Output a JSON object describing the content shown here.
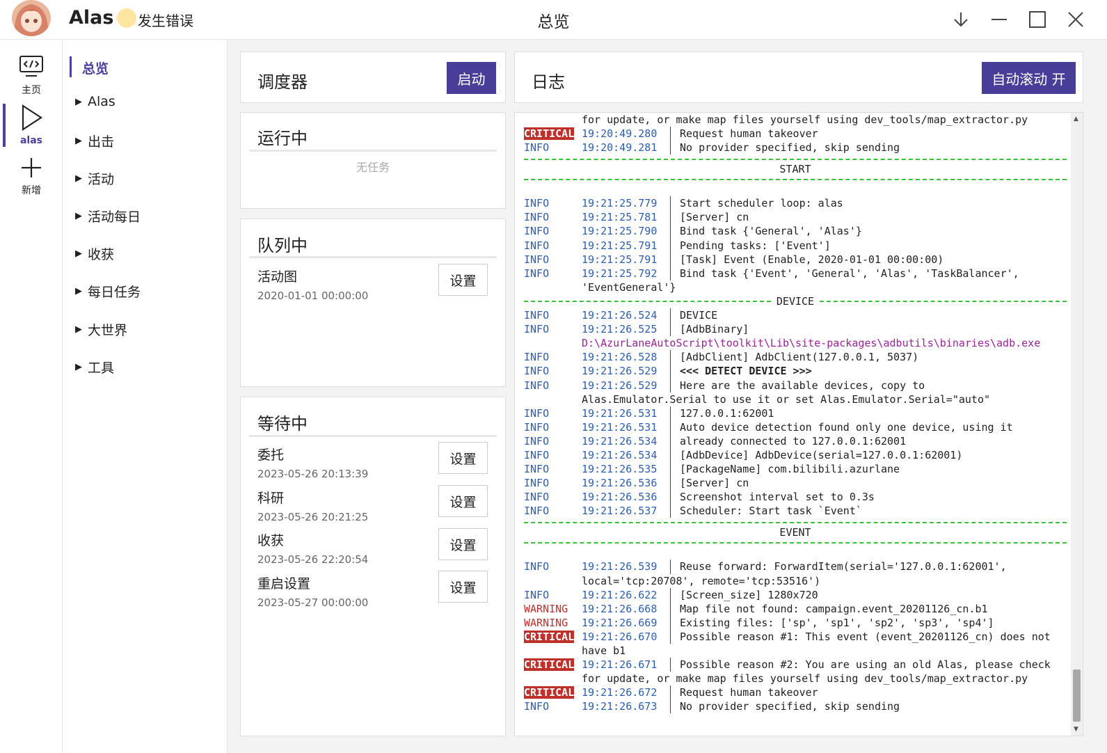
{
  "titlebar": {
    "app_name": "Alas",
    "status": "发生错误",
    "page_title": "总览"
  },
  "rail": {
    "items": [
      {
        "label": "主页",
        "icon": "code-monitor-icon"
      },
      {
        "label": "alas",
        "icon": "play-icon"
      },
      {
        "label": "新增",
        "icon": "plus-icon"
      }
    ]
  },
  "menu": {
    "active": "总览",
    "items": [
      "Alas",
      "出击",
      "活动",
      "活动每日",
      "收获",
      "每日任务",
      "大世界",
      "工具"
    ]
  },
  "scheduler": {
    "title": "调度器",
    "start_label": "启动"
  },
  "running": {
    "title": "运行中",
    "empty": "无任务"
  },
  "pending": {
    "title": "队列中",
    "tasks": [
      {
        "name": "活动图",
        "time": "2020-01-01 00:00:00",
        "button": "设置"
      }
    ]
  },
  "waiting": {
    "title": "等待中",
    "tasks": [
      {
        "name": "委托",
        "time": "2023-05-26 20:13:39",
        "button": "设置"
      },
      {
        "name": "科研",
        "time": "2023-05-26 20:21:25",
        "button": "设置"
      },
      {
        "name": "收获",
        "time": "2023-05-26 22:20:54",
        "button": "设置"
      },
      {
        "name": "重启设置",
        "time": "2023-05-27 00:00:00",
        "button": "设置"
      }
    ]
  },
  "log": {
    "title": "日志",
    "autoscroll_label": "自动滚动 开",
    "colors": {
      "info": "#2b5eb8",
      "warning": "#c0302b",
      "critical_bg": "#c0302b",
      "separator": "#36c436",
      "path": "#a0219e"
    },
    "lines": {
      "c0": "for update, or make map files yourself using dev_tools/map_extractor.py",
      "l1": {
        "level": "CRITICAL",
        "time": "19:20:49.280",
        "msg": "Request human takeover"
      },
      "l2": {
        "level": "INFO",
        "time": "19:20:49.281",
        "msg": "No provider specified, skip sending"
      },
      "banner_start": "START",
      "l3": {
        "level": "INFO",
        "time": "19:21:25.779",
        "msg": "Start scheduler loop: alas"
      },
      "l4": {
        "level": "INFO",
        "time": "19:21:25.781",
        "msg": "[Server] cn"
      },
      "l5": {
        "level": "INFO",
        "time": "19:21:25.790",
        "msg": "Bind task {'General', 'Alas'}"
      },
      "l6": {
        "level": "INFO",
        "time": "19:21:25.791",
        "msg": "Pending tasks: ['Event']"
      },
      "l7": {
        "level": "INFO",
        "time": "19:21:25.791",
        "msg": "[Task] Event (Enable, 2020-01-01 00:00:00)"
      },
      "l8": {
        "level": "INFO",
        "time": "19:21:25.792",
        "msg": "Bind task {'Event', 'General', 'Alas', 'TaskBalancer',"
      },
      "c8": "'EventGeneral'}",
      "banner_device": "DEVICE",
      "l9": {
        "level": "INFO",
        "time": "19:21:26.524",
        "msg": "DEVICE"
      },
      "l10": {
        "level": "INFO",
        "time": "19:21:26.525",
        "msg": "[AdbBinary]"
      },
      "c10": "D:\\AzurLaneAutoScript\\toolkit\\Lib\\site-packages\\adbutils\\binaries\\adb.exe",
      "l11": {
        "level": "INFO",
        "time": "19:21:26.528",
        "msg": "[AdbClient] AdbClient(127.0.0.1, 5037)"
      },
      "l12": {
        "level": "INFO",
        "time": "19:21:26.529",
        "msg": "<<< DETECT DEVICE >>>"
      },
      "l13": {
        "level": "INFO",
        "time": "19:21:26.529",
        "msg": "Here are the available devices, copy to"
      },
      "c13": "Alas.Emulator.Serial to use it or set Alas.Emulator.Serial=\"auto\"",
      "l14": {
        "level": "INFO",
        "time": "19:21:26.531",
        "msg": "127.0.0.1:62001"
      },
      "l15": {
        "level": "INFO",
        "time": "19:21:26.531",
        "msg": "Auto device detection found only one device, using it"
      },
      "l16": {
        "level": "INFO",
        "time": "19:21:26.534",
        "msg": "already connected to 127.0.0.1:62001"
      },
      "l17": {
        "level": "INFO",
        "time": "19:21:26.534",
        "msg": "[AdbDevice] AdbDevice(serial=127.0.0.1:62001)"
      },
      "l18": {
        "level": "INFO",
        "time": "19:21:26.535",
        "msg": "[PackageName] com.bilibili.azurlane"
      },
      "l19": {
        "level": "INFO",
        "time": "19:21:26.536",
        "msg": "[Server] cn"
      },
      "l20": {
        "level": "INFO",
        "time": "19:21:26.536",
        "msg": "Screenshot interval set to 0.3s"
      },
      "l21": {
        "level": "INFO",
        "time": "19:21:26.537",
        "msg": "Scheduler: Start task `Event`"
      },
      "banner_event": "EVENT",
      "l22": {
        "level": "INFO",
        "time": "19:21:26.539",
        "msg": "Reuse forward: ForwardItem(serial='127.0.0.1:62001',"
      },
      "c22": "local='tcp:20708', remote='tcp:53516')",
      "l23": {
        "level": "INFO",
        "time": "19:21:26.622",
        "msg": "[Screen_size] 1280x720"
      },
      "l24": {
        "level": "WARNING",
        "time": "19:21:26.668",
        "msg": "Map file not found: campaign.event_20201126_cn.b1"
      },
      "l25": {
        "level": "WARNING",
        "time": "19:21:26.669",
        "msg": "Existing files: ['sp', 'sp1', 'sp2', 'sp3', 'sp4']"
      },
      "l26": {
        "level": "CRITICAL",
        "time": "19:21:26.670",
        "msg": "Possible reason #1: This event (event_20201126_cn) does not"
      },
      "c26": "have b1",
      "l27": {
        "level": "CRITICAL",
        "time": "19:21:26.671",
        "msg": "Possible reason #2: You are using an old Alas, please check"
      },
      "c27": "for update, or make map files yourself using dev_tools/map_extractor.py",
      "l28": {
        "level": "CRITICAL",
        "time": "19:21:26.672",
        "msg": "Request human takeover"
      },
      "l29": {
        "level": "INFO",
        "time": "19:21:26.673",
        "msg": "No provider specified, skip sending"
      }
    }
  }
}
